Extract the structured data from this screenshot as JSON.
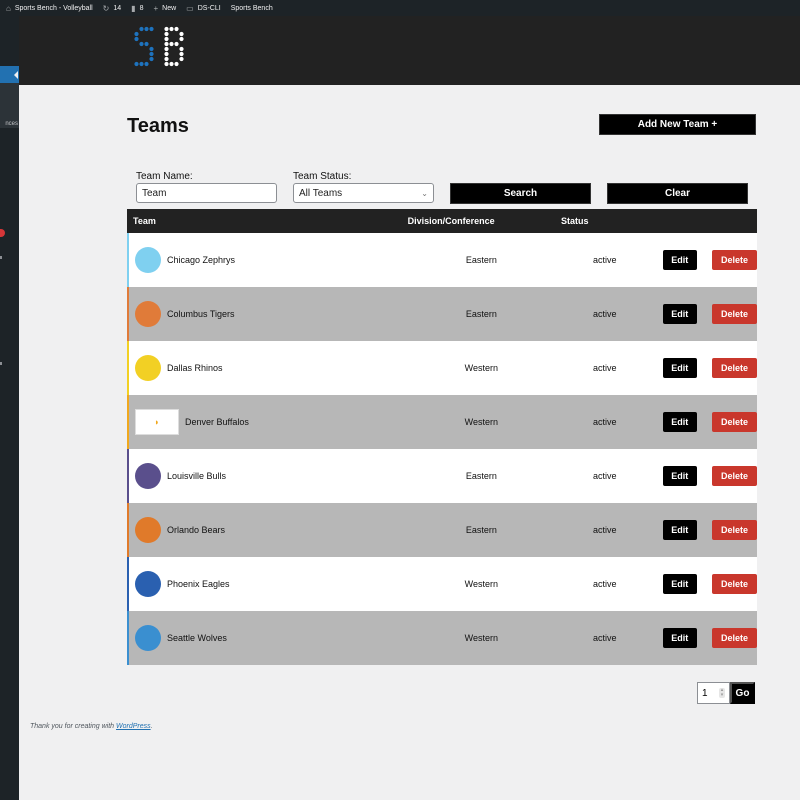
{
  "adminbar": {
    "site_name": "Sports Bench - Volleyball",
    "updates_count": "14",
    "comments_count": "8",
    "new_label": "New",
    "ds_cli_label": "DS-CLI",
    "sports_bench_label": "Sports Bench"
  },
  "sidebar": {
    "submenu_label": "nces"
  },
  "header": {
    "logo_text": "SB",
    "logo_colors": {
      "s": "#1e73be",
      "b": "#ffffff"
    }
  },
  "page": {
    "title": "Teams",
    "add_button_label": "Add New Team +"
  },
  "filters": {
    "team_name_label": "Team Name:",
    "team_name_value": "Team",
    "team_status_label": "Team Status:",
    "team_status_value": "All Teams",
    "search_label": "Search",
    "clear_label": "Clear"
  },
  "table": {
    "headers": {
      "team": "Team",
      "division": "Division/Conference",
      "status": "Status"
    },
    "edit_label": "Edit",
    "delete_label": "Delete",
    "rows": [
      {
        "name": "Chicago Zephrys",
        "division": "Eastern",
        "status": "active",
        "color": "#7fd0f0",
        "logo": "CZ"
      },
      {
        "name": "Columbus Tigers",
        "division": "Eastern",
        "status": "active",
        "color": "#e07b39",
        "logo": "CT"
      },
      {
        "name": "Dallas Rhinos",
        "division": "Western",
        "status": "active",
        "color": "#f2d024",
        "logo": "DR"
      },
      {
        "name": "Denver Buffalos",
        "division": "Western",
        "status": "active",
        "color": "#f0a81e",
        "logo": "DB"
      },
      {
        "name": "Louisville Bulls",
        "division": "Eastern",
        "status": "active",
        "color": "#5a4f8c",
        "logo": "LB"
      },
      {
        "name": "Orlando Bears",
        "division": "Eastern",
        "status": "active",
        "color": "#e07a2a",
        "logo": "OB"
      },
      {
        "name": "Phoenix Eagles",
        "division": "Western",
        "status": "active",
        "color": "#2a60b0",
        "logo": "PE"
      },
      {
        "name": "Seattle Wolves",
        "division": "Western",
        "status": "active",
        "color": "#3a8fd0",
        "logo": "SW"
      }
    ]
  },
  "pagination": {
    "page_value": "1",
    "go_label": "Go"
  },
  "footer": {
    "text": "Thank you for creating with ",
    "link": "WordPress",
    "suffix": "."
  }
}
